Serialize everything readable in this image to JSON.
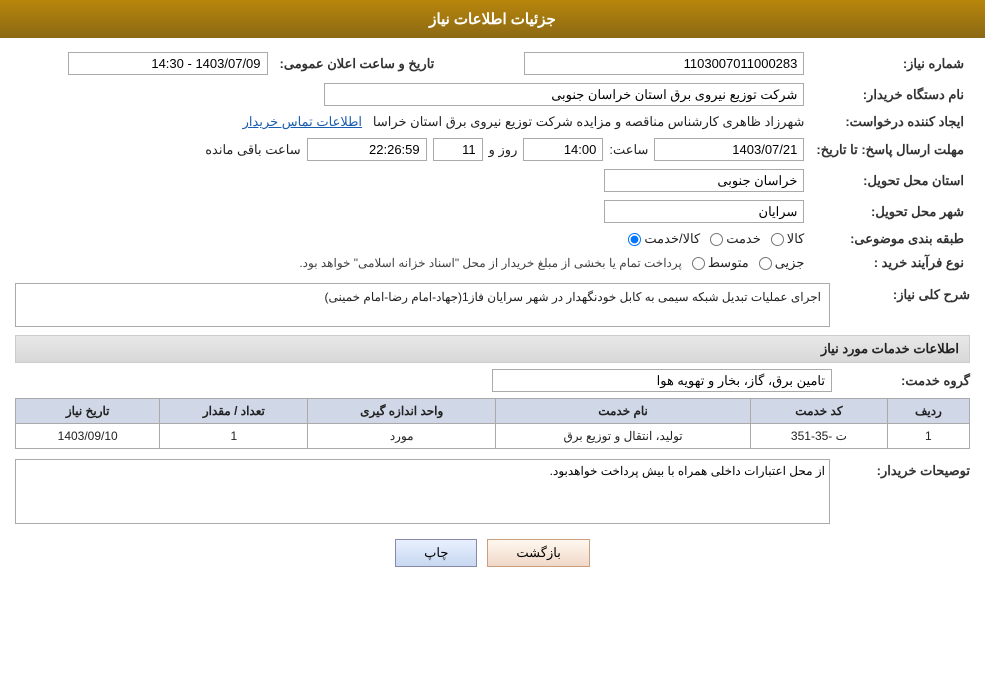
{
  "header": {
    "title": "جزئیات اطلاعات نیاز"
  },
  "fields": {
    "shomara_label": "شماره نیاز:",
    "shomara_value": "1103007011000283",
    "tarikh_label": "تاریخ و ساعت اعلان عمومی:",
    "tarikh_value": "1403/07/09 - 14:30",
    "nam_dastgah_label": "نام دستگاه خریدار:",
    "nam_dastgah_value": "شرکت توزیع نیروی برق استان خراسان جنوبی",
    "ijad_label": "ایجاد کننده درخواست:",
    "ijad_value": "شهرزاد ظاهری کارشناس مناقصه و مزایده شرکت توزیع نیروی برق استان خراسا",
    "ijad_link": "اطلاعات تماس خریدار",
    "mohlat_label": "مهلت ارسال پاسخ: تا تاریخ:",
    "mohlat_date": "1403/07/21",
    "mohlat_saat_label": "ساعت:",
    "mohlat_saat": "14:00",
    "mohlat_rooz_label": "روز و",
    "mohlat_rooz": "11",
    "mohlat_mande_label": "ساعت باقی مانده",
    "mohlat_mande": "22:26:59",
    "ostan_label": "استان محل تحویل:",
    "ostan_value": "خراسان جنوبی",
    "shahr_label": "شهر محل تحویل:",
    "shahr_value": "سرایان",
    "tabaqe_label": "طبقه بندی موضوعی:",
    "tabaqe_kala": "کالا",
    "tabaqe_khadamat": "خدمت",
    "tabaqe_kala_khadamat": "کالا/خدمت",
    "tabaqe_selected": "kala_khadamat",
    "nofarayand_label": "نوع فرآیند خرید :",
    "nofarayand_jazzi": "جزیی",
    "nofarayand_motevaset": "متوسط",
    "nofarayand_text": "پرداخت تمام یا بخشی از مبلغ خریدار از محل \"اسناد خزانه اسلامی\" خواهد بود.",
    "sharh_label": "شرح کلی نیاز:",
    "sharh_text": "اجرای عملیات تبدیل شبکه سیمی به کابل خودنگهدار در شهر سرایان فاز1(جهاد-امام رضا-امام خمینی)",
    "khadamat_label": "اطلاعات خدمات مورد نیاز",
    "goroh_label": "گروه خدمت:",
    "goroh_value": "تامین برق، گاز، بخار و تهویه هوا",
    "table_headers": [
      "ردیف",
      "کد خدمت",
      "نام خدمت",
      "واحد اندازه گیری",
      "تعداد / مقدار",
      "تاریخ نیاز"
    ],
    "table_rows": [
      {
        "radif": "1",
        "kod": "ت -35-351",
        "nam": "تولید، انتقال و توزیع برق",
        "vahed": "مورد",
        "tedad": "1",
        "tarikh": "1403/09/10"
      }
    ],
    "toseeh_label": "توصیحات خریدار:",
    "toseeh_text": "از محل اعتبارات داخلی همراه با بیش پرداخت خواهدبود.",
    "btn_print": "چاپ",
    "btn_back": "بازگشت"
  }
}
